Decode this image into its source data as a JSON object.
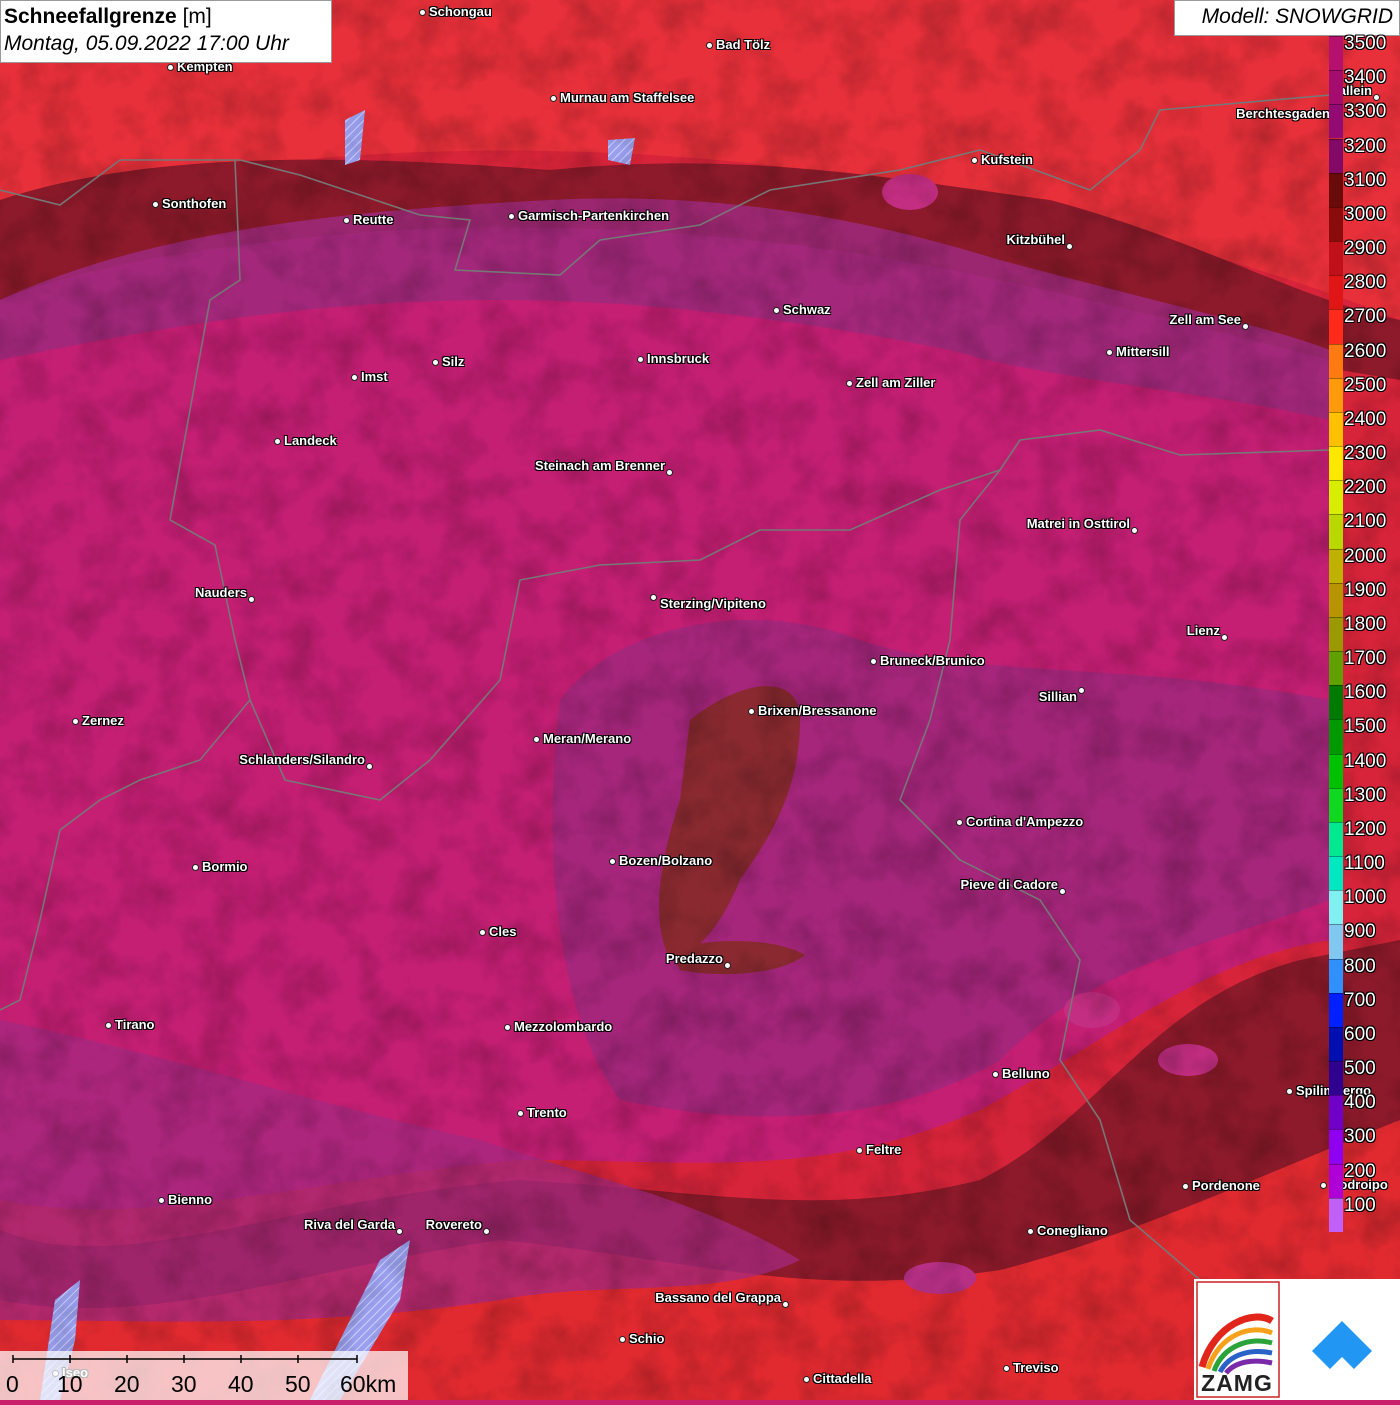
{
  "title": {
    "main": "Schneefallgrenze",
    "unit": "[m]",
    "datetime": "Montag, 05.09.2022 17:00 Uhr"
  },
  "model": "Modell: SNOWGRID",
  "legend": {
    "levels": [
      {
        "value": "3500",
        "color": "#b5106e"
      },
      {
        "value": "3400",
        "color": "#a40c6e"
      },
      {
        "value": "3300",
        "color": "#930a72"
      },
      {
        "value": "3200",
        "color": "#820a66"
      },
      {
        "value": "3100",
        "color": "#6a0b0b"
      },
      {
        "value": "3000",
        "color": "#8a0b0b"
      },
      {
        "value": "2900",
        "color": "#c0101a"
      },
      {
        "value": "2800",
        "color": "#e01515"
      },
      {
        "value": "2700",
        "color": "#ff2a1a"
      },
      {
        "value": "2600",
        "color": "#ff7a10"
      },
      {
        "value": "2500",
        "color": "#ff9a0a"
      },
      {
        "value": "2400",
        "color": "#ffc000"
      },
      {
        "value": "2300",
        "color": "#ffe800"
      },
      {
        "value": "2200",
        "color": "#d8ee00"
      },
      {
        "value": "2100",
        "color": "#b8d800"
      },
      {
        "value": "2000",
        "color": "#c0b000"
      },
      {
        "value": "1900",
        "color": "#b89400"
      },
      {
        "value": "1800",
        "color": "#9a9a00"
      },
      {
        "value": "1700",
        "color": "#60a000"
      },
      {
        "value": "1600",
        "color": "#007a00"
      },
      {
        "value": "1500",
        "color": "#009a00"
      },
      {
        "value": "1400",
        "color": "#00c000"
      },
      {
        "value": "1300",
        "color": "#10d820"
      },
      {
        "value": "1200",
        "color": "#00e890"
      },
      {
        "value": "1100",
        "color": "#00e8c0"
      },
      {
        "value": "1000",
        "color": "#80f0f0"
      },
      {
        "value": "900",
        "color": "#80c8f0"
      },
      {
        "value": "800",
        "color": "#3090ff"
      },
      {
        "value": "700",
        "color": "#0020ff"
      },
      {
        "value": "600",
        "color": "#0010b0"
      },
      {
        "value": "500",
        "color": "#300090"
      },
      {
        "value": "400",
        "color": "#7000c8"
      },
      {
        "value": "300",
        "color": "#9000f0"
      },
      {
        "value": "200",
        "color": "#b000d8"
      },
      {
        "value": "100",
        "color": "#c060f8"
      }
    ]
  },
  "cities": [
    {
      "name": "Schongau"
    },
    {
      "name": "Bad Tölz"
    },
    {
      "name": "Kempten"
    },
    {
      "name": "Murnau am Staffelsee"
    },
    {
      "name": "Hallein"
    },
    {
      "name": "Berchtesgaden"
    },
    {
      "name": "Kufstein"
    },
    {
      "name": "Sonthofen"
    },
    {
      "name": "Reutte"
    },
    {
      "name": "Garmisch-Partenkirchen"
    },
    {
      "name": "Kitzbühel"
    },
    {
      "name": "Schwaz"
    },
    {
      "name": "Zell am See"
    },
    {
      "name": "Innsbruck"
    },
    {
      "name": "Mittersill"
    },
    {
      "name": "Silz"
    },
    {
      "name": "Imst"
    },
    {
      "name": "Zell am Ziller"
    },
    {
      "name": "Landeck"
    },
    {
      "name": "Steinach am Brenner"
    },
    {
      "name": "Matrei in Osttirol"
    },
    {
      "name": "Nauders"
    },
    {
      "name": "Sterzing/Vipiteno"
    },
    {
      "name": "Lienz"
    },
    {
      "name": "Bruneck/Brunico"
    },
    {
      "name": "Sillian"
    },
    {
      "name": "Brixen/Bressanone"
    },
    {
      "name": "Zernez"
    },
    {
      "name": "Meran/Merano"
    },
    {
      "name": "Schlanders/Silandro"
    },
    {
      "name": "Cortina d'Ampezzo"
    },
    {
      "name": "Bozen/Bolzano"
    },
    {
      "name": "Bormio"
    },
    {
      "name": "Pieve di Cadore"
    },
    {
      "name": "Cles"
    },
    {
      "name": "Predazzo"
    },
    {
      "name": "Tirano"
    },
    {
      "name": "Mezzolombardo"
    },
    {
      "name": "Belluno"
    },
    {
      "name": "Spilimbergo"
    },
    {
      "name": "Trento"
    },
    {
      "name": "Feltre"
    },
    {
      "name": "Pordenone"
    },
    {
      "name": "Codroipo"
    },
    {
      "name": "Bienno"
    },
    {
      "name": "Riva del Garda"
    },
    {
      "name": "Rovereto"
    },
    {
      "name": "Conegliano"
    },
    {
      "name": "Bassano del Grappa"
    },
    {
      "name": "Schio"
    },
    {
      "name": "Iseo"
    },
    {
      "name": "Treviso"
    },
    {
      "name": "Cittadella"
    }
  ],
  "scalebar": {
    "labels": [
      "0",
      "10",
      "20",
      "30",
      "40",
      "50",
      "60km"
    ]
  },
  "logo": {
    "text": "ZAMG"
  }
}
